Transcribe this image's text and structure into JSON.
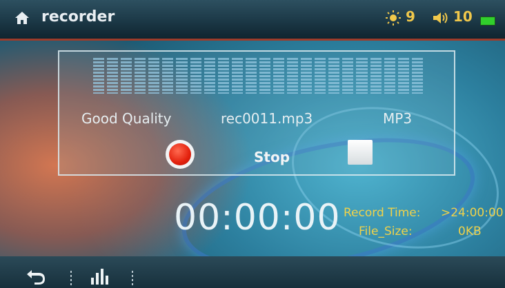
{
  "header": {
    "title": "recorder",
    "brightness": "9",
    "volume": "10"
  },
  "recorder": {
    "quality": "Good Quality",
    "filename": "rec0011.mp3",
    "format": "MP3",
    "stop_label": "Stop"
  },
  "status": {
    "timer": "00:00:00",
    "record_time_label": "Record Time:",
    "record_time_value": ">24:00:00",
    "file_size_label": "File_Size:",
    "file_size_value": "0KB"
  },
  "icons": {
    "home": "home-icon",
    "brightness": "sun-icon",
    "volume": "speaker-icon",
    "battery": "battery-icon",
    "record": "record-icon",
    "stop": "stop-icon",
    "back": "back-arrow-icon",
    "equalizer": "equalizer-icon"
  },
  "colors": {
    "accent_text": "#f0d24a",
    "record_red": "#e3210d",
    "battery_green": "#31d02c"
  }
}
